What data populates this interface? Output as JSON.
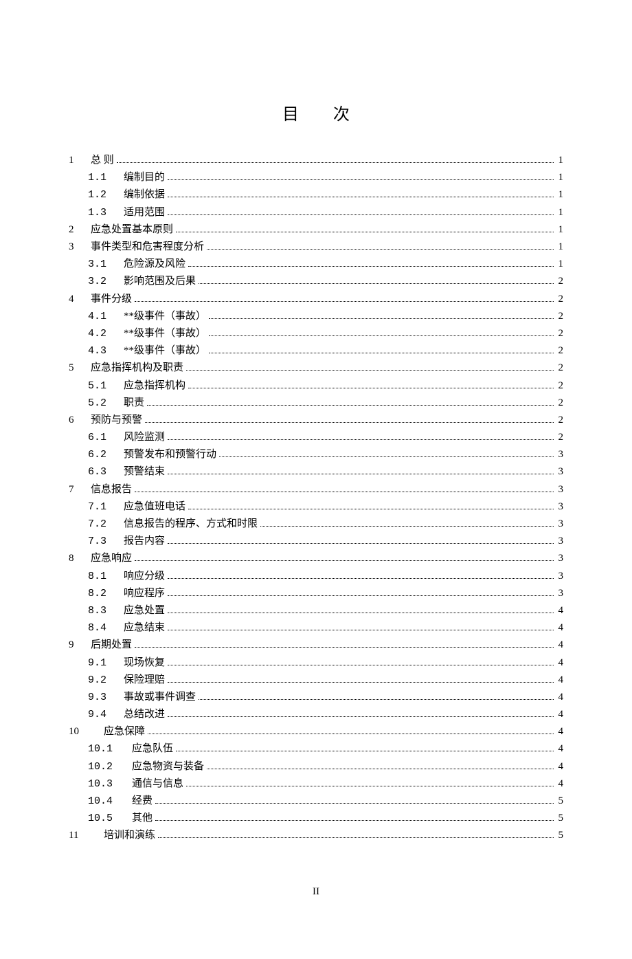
{
  "title": "目次",
  "pageNumber": "II",
  "toc": [
    {
      "type": "sec",
      "num": "1",
      "label": "总 则",
      "page": "1"
    },
    {
      "type": "sub",
      "num": "1.1",
      "label": "编制目的",
      "page": "1"
    },
    {
      "type": "sub",
      "num": "1.2",
      "label": "编制依据",
      "page": "1"
    },
    {
      "type": "sub",
      "num": "1.3",
      "label": "适用范围",
      "page": "1"
    },
    {
      "type": "sec",
      "num": "2",
      "label": "应急处置基本原则",
      "page": "1"
    },
    {
      "type": "sec",
      "num": "3",
      "label": "事件类型和危害程度分析",
      "page": "1"
    },
    {
      "type": "sub",
      "num": "3.1",
      "label": "危险源及风险",
      "page": "1"
    },
    {
      "type": "sub",
      "num": "3.2",
      "label": "影响范围及后果",
      "page": "2"
    },
    {
      "type": "sec",
      "num": "4",
      "label": "事件分级",
      "page": "2"
    },
    {
      "type": "sub",
      "num": "4.1",
      "label": "**级事件（事故）",
      "page": "2"
    },
    {
      "type": "sub",
      "num": "4.2",
      "label": "**级事件（事故）",
      "page": "2"
    },
    {
      "type": "sub",
      "num": "4.3",
      "label": "**级事件（事故）",
      "page": "2"
    },
    {
      "type": "sec",
      "num": "5",
      "label": "应急指挥机构及职责",
      "page": "2"
    },
    {
      "type": "sub",
      "num": "5.1",
      "label": "应急指挥机构",
      "page": "2"
    },
    {
      "type": "sub",
      "num": "5.2",
      "label": "职责",
      "page": "2"
    },
    {
      "type": "sec",
      "num": "6",
      "label": "预防与预警",
      "page": "2"
    },
    {
      "type": "sub",
      "num": "6.1",
      "label": "风险监测",
      "page": "2"
    },
    {
      "type": "sub",
      "num": "6.2",
      "label": "预警发布和预警行动",
      "page": "3"
    },
    {
      "type": "sub",
      "num": "6.3",
      "label": "预警结束",
      "page": "3"
    },
    {
      "type": "sec",
      "num": "7",
      "label": "信息报告",
      "page": "3"
    },
    {
      "type": "sub",
      "num": "7.1",
      "label": "应急值班电话",
      "page": "3"
    },
    {
      "type": "sub",
      "num": "7.2",
      "label": "信息报告的程序、方式和时限",
      "page": "3"
    },
    {
      "type": "sub",
      "num": "7.3",
      "label": "报告内容",
      "page": "3"
    },
    {
      "type": "sec",
      "num": "8",
      "label": "应急响应",
      "page": "3"
    },
    {
      "type": "sub",
      "num": "8.1",
      "label": "响应分级",
      "page": "3"
    },
    {
      "type": "sub",
      "num": "8.2",
      "label": "响应程序",
      "page": "3"
    },
    {
      "type": "sub",
      "num": "8.3",
      "label": "应急处置",
      "page": "4"
    },
    {
      "type": "sub",
      "num": "8.4",
      "label": "应急结束",
      "page": "4"
    },
    {
      "type": "sec",
      "num": "9",
      "label": "后期处置",
      "page": "4"
    },
    {
      "type": "sub",
      "num": "9.1",
      "label": "现场恢复",
      "page": "4"
    },
    {
      "type": "sub",
      "num": "9.2",
      "label": "保险理赔",
      "page": "4"
    },
    {
      "type": "sub",
      "num": "9.3",
      "label": "事故或事件调查",
      "page": "4"
    },
    {
      "type": "sub",
      "num": "9.4",
      "label": "总结改进",
      "page": "4"
    },
    {
      "type": "sec",
      "num": "10",
      "label": "应急保障",
      "page": "4",
      "wide": true
    },
    {
      "type": "sub",
      "num": "10.1",
      "label": "应急队伍",
      "page": "4",
      "wide": true
    },
    {
      "type": "sub",
      "num": "10.2",
      "label": "应急物资与装备",
      "page": "4",
      "wide": true
    },
    {
      "type": "sub",
      "num": "10.3",
      "label": "通信与信息",
      "page": "4",
      "wide": true
    },
    {
      "type": "sub",
      "num": "10.4",
      "label": "经费",
      "page": "5",
      "wide": true
    },
    {
      "type": "sub",
      "num": "10.5",
      "label": "其他",
      "page": "5",
      "wide": true
    },
    {
      "type": "sec",
      "num": "11",
      "label": "培训和演练",
      "page": "5",
      "wide": true
    }
  ]
}
